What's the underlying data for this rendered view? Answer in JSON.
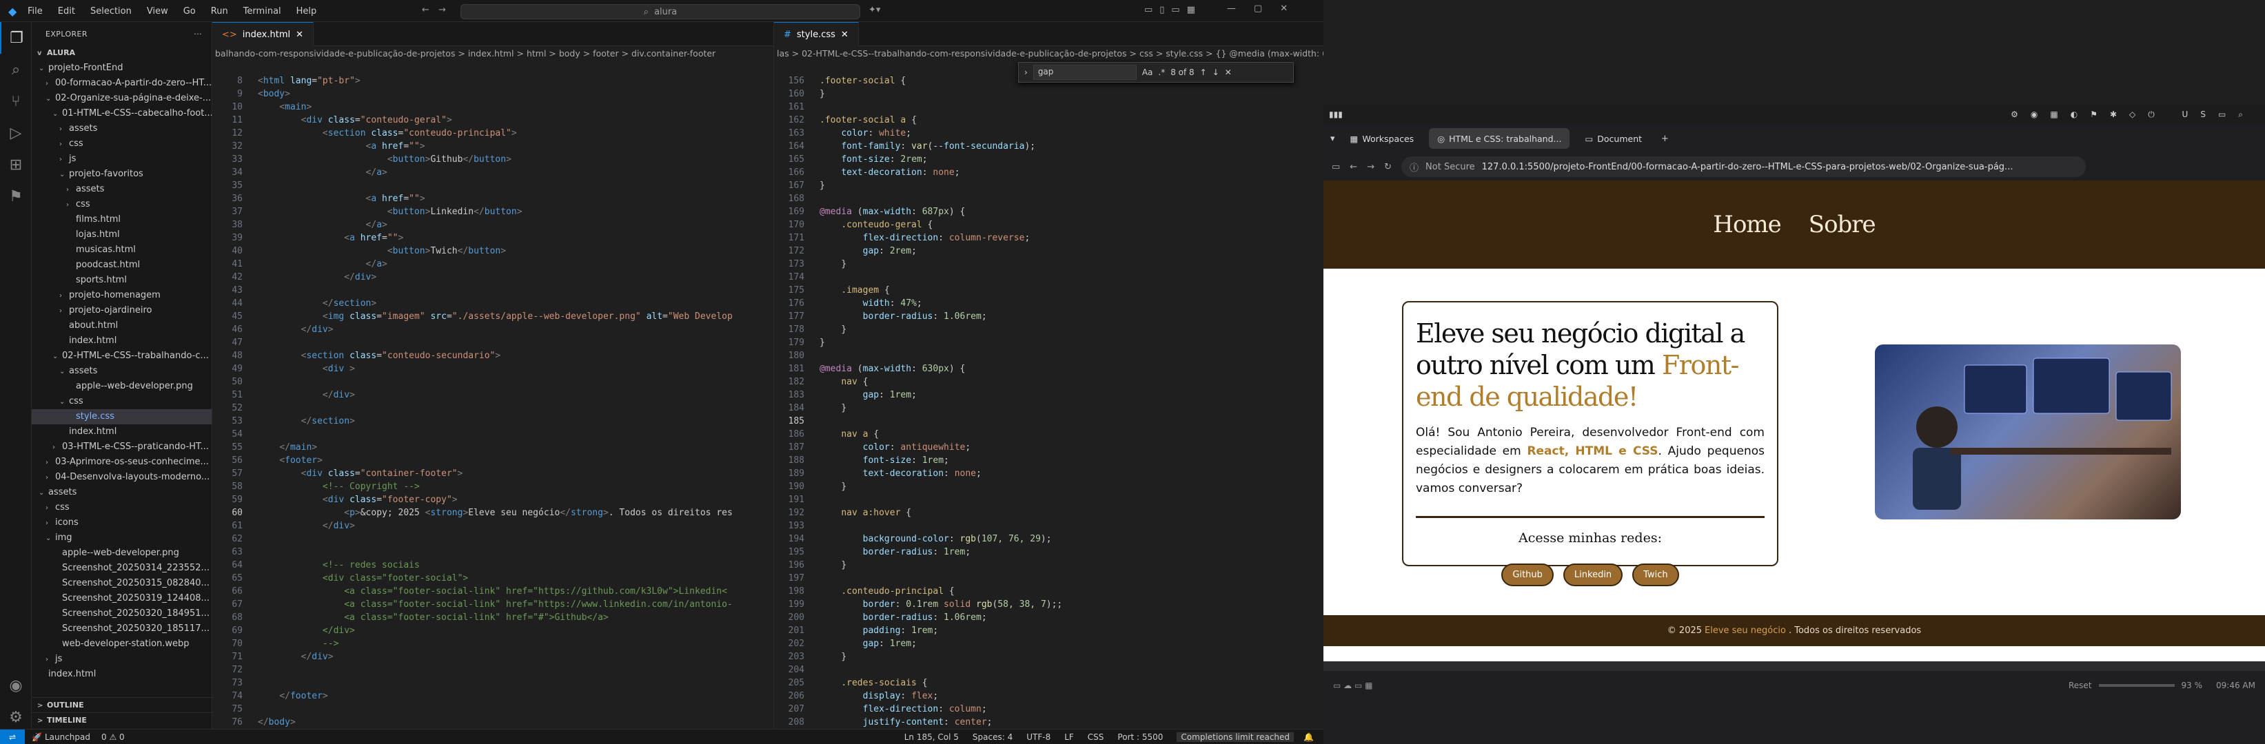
{
  "vscode": {
    "menu": [
      "File",
      "Edit",
      "Selection",
      "View",
      "Go",
      "Run",
      "Terminal",
      "Help"
    ],
    "search": "alura",
    "explorer_title": "EXPLORER",
    "root": "ALURA",
    "tree": [
      {
        "indent": 1,
        "chev": "v",
        "label": "projeto-FrontEnd"
      },
      {
        "indent": 2,
        "chev": ">",
        "label": "00-formacao-A-partir-do-zero--HT..."
      },
      {
        "indent": 2,
        "chev": "v",
        "label": "02-Organize-sua-página-e-deixe-..."
      },
      {
        "indent": 3,
        "chev": "v",
        "label": "01-HTML-e-CSS--cabecalho-foot..."
      },
      {
        "indent": 4,
        "chev": ">",
        "label": "assets"
      },
      {
        "indent": 4,
        "chev": ">",
        "label": "css"
      },
      {
        "indent": 4,
        "chev": ">",
        "label": "js"
      },
      {
        "indent": 4,
        "chev": "v",
        "label": "projeto-favoritos"
      },
      {
        "indent": 5,
        "chev": ">",
        "label": "assets"
      },
      {
        "indent": 5,
        "chev": ">",
        "label": "css"
      },
      {
        "indent": 5,
        "chev": "",
        "label": "films.html"
      },
      {
        "indent": 5,
        "chev": "",
        "label": "lojas.html"
      },
      {
        "indent": 5,
        "chev": "",
        "label": "musicas.html"
      },
      {
        "indent": 5,
        "chev": "",
        "label": "poodcast.html"
      },
      {
        "indent": 5,
        "chev": "",
        "label": "sports.html"
      },
      {
        "indent": 4,
        "chev": ">",
        "label": "projeto-homenagem"
      },
      {
        "indent": 4,
        "chev": ">",
        "label": "projeto-ojardineiro"
      },
      {
        "indent": 4,
        "chev": "",
        "label": "about.html"
      },
      {
        "indent": 4,
        "chev": "",
        "label": "index.html"
      },
      {
        "indent": 3,
        "chev": "v",
        "label": "02-HTML-e-CSS--trabalhando-c..."
      },
      {
        "indent": 4,
        "chev": "v",
        "label": "assets"
      },
      {
        "indent": 5,
        "chev": "",
        "label": "apple--web-developer.png"
      },
      {
        "indent": 4,
        "chev": "v",
        "label": "css"
      },
      {
        "indent": 5,
        "chev": "",
        "label": "style.css",
        "sel": true
      },
      {
        "indent": 4,
        "chev": "",
        "label": "index.html"
      },
      {
        "indent": 3,
        "chev": ">",
        "label": "03-HTML-e-CSS--praticando-HT..."
      },
      {
        "indent": 2,
        "chev": ">",
        "label": "03-Aprimore-os-seus-conhecime..."
      },
      {
        "indent": 2,
        "chev": ">",
        "label": "04-Desenvolva-layouts-moderno..."
      },
      {
        "indent": 1,
        "chev": "v",
        "label": "assets"
      },
      {
        "indent": 2,
        "chev": ">",
        "label": "css"
      },
      {
        "indent": 2,
        "chev": ">",
        "label": "icons"
      },
      {
        "indent": 2,
        "chev": "v",
        "label": "img"
      },
      {
        "indent": 3,
        "chev": "",
        "label": "apple--web-developer.png"
      },
      {
        "indent": 3,
        "chev": "",
        "label": "Screenshot_20250314_223552..."
      },
      {
        "indent": 3,
        "chev": "",
        "label": "Screenshot_20250315_082840..."
      },
      {
        "indent": 3,
        "chev": "",
        "label": "Screenshot_20250319_124408..."
      },
      {
        "indent": 3,
        "chev": "",
        "label": "Screenshot_20250320_184951..."
      },
      {
        "indent": 3,
        "chev": "",
        "label": "Screenshot_20250320_185117..."
      },
      {
        "indent": 3,
        "chev": "",
        "label": "web-developer-station.webp"
      },
      {
        "indent": 2,
        "chev": ">",
        "label": "js"
      },
      {
        "indent": 1,
        "chev": "",
        "label": "index.html"
      }
    ],
    "outline": "OUTLINE",
    "timeline": "TIMELINE",
    "tab_left": "index.html",
    "tab_right": "style.css",
    "crumb_left": "balhando-com-responsividade-e-publicação-de-projetos > index.html > html > body > footer > div.container-footer",
    "crumb_right": "las > 02-HTML-e-CSS--trabalhando-com-responsividade-e-publicação-de-projetos > css > style.css > {} @media (max-width: 630px",
    "find": {
      "query": "gap",
      "count": "8 of 8"
    },
    "status": {
      "launchpad": "Launchpad",
      "problems": "0 ⚠ 0",
      "pos": "Ln 185, Col 5",
      "spaces": "Spaces: 4",
      "enc": "UTF-8",
      "eol": "LF",
      "lang": "CSS",
      "port": "Port : 5500",
      "limit": "Completions limit reached"
    }
  },
  "browser": {
    "workspaces": "Workspaces",
    "tab1": "HTML e CSS: trabalhand...",
    "tab2": "Document",
    "not_secure": "Not Secure",
    "url": "127.0.0.1:5500/projeto-FrontEnd/00-formacao-A-partir-do-zero--HTML-e-CSS-para-projetos-web/02-Organize-sua-pág...",
    "zoom": "93 %",
    "time": "09:46 AM",
    "reset": "Reset"
  },
  "site": {
    "nav": [
      "Home",
      "Sobre"
    ],
    "title_pre": "Eleve seu negócio digital a outro nível com um",
    "title_hl": "Front-end de qualidade!",
    "p_pre": "Olá! Sou Antonio Pereira, desenvolvedor Front-end com especialidade em",
    "p_hl": "React, HTML e CSS",
    "p_post": ". Ajudo pequenos negócios e designers a colocarem em prática boas ideias. vamos conversar?",
    "redes_title": "Acesse minhas redes:",
    "redes": [
      "Github",
      "Linkedin",
      "Twich"
    ],
    "footer_pre": "© 2025",
    "footer_hl": "Eleve seu negócio",
    "footer_post": ". Todos os direitos reservados",
    "colors": {
      "brown": "#3a260f",
      "accent": "#b07d2a"
    }
  }
}
